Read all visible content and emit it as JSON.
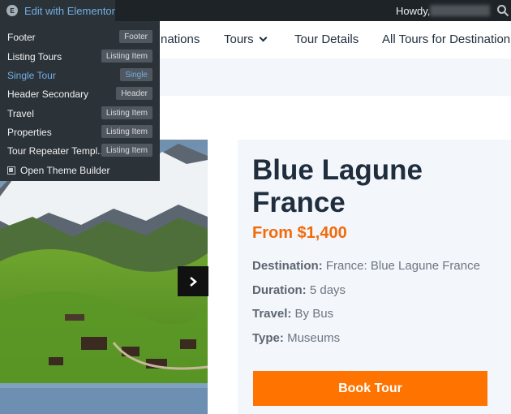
{
  "admin_bar": {
    "edit_label": "Edit with Elementor",
    "logo_glyph": "E",
    "howdy": "Howdy,"
  },
  "dropdown": {
    "items": [
      {
        "label": "Footer",
        "badge": "Footer"
      },
      {
        "label": "Listing Tours",
        "badge": "Listing Item"
      },
      {
        "label": "Single Tour",
        "badge": "Single"
      },
      {
        "label": "Header Secondary",
        "badge": "Header"
      },
      {
        "label": "Travel",
        "badge": "Listing Item"
      },
      {
        "label": "Properties",
        "badge": "Listing Item"
      },
      {
        "label": "Tour Repeater Templ...",
        "badge": "Listing Item"
      }
    ],
    "theme_builder": "Open Theme Builder"
  },
  "nav": {
    "items": [
      "nations",
      "Tours",
      "Tour Details",
      "All Tours for Destination"
    ]
  },
  "tour": {
    "title": "Blue Lagune France",
    "price": "From $1,400",
    "destination_label": "Destination:",
    "destination_value": "France: Blue Lagune France",
    "duration_label": "Duration:",
    "duration_value": "5 days",
    "travel_label": "Travel:",
    "travel_value": "By Bus",
    "type_label": "Type:",
    "type_value": "Museums",
    "book_label": "Book Tour"
  },
  "colors": {
    "accent": "#ff7400",
    "price": "#f26b0b",
    "admin_link": "#72aee6"
  }
}
